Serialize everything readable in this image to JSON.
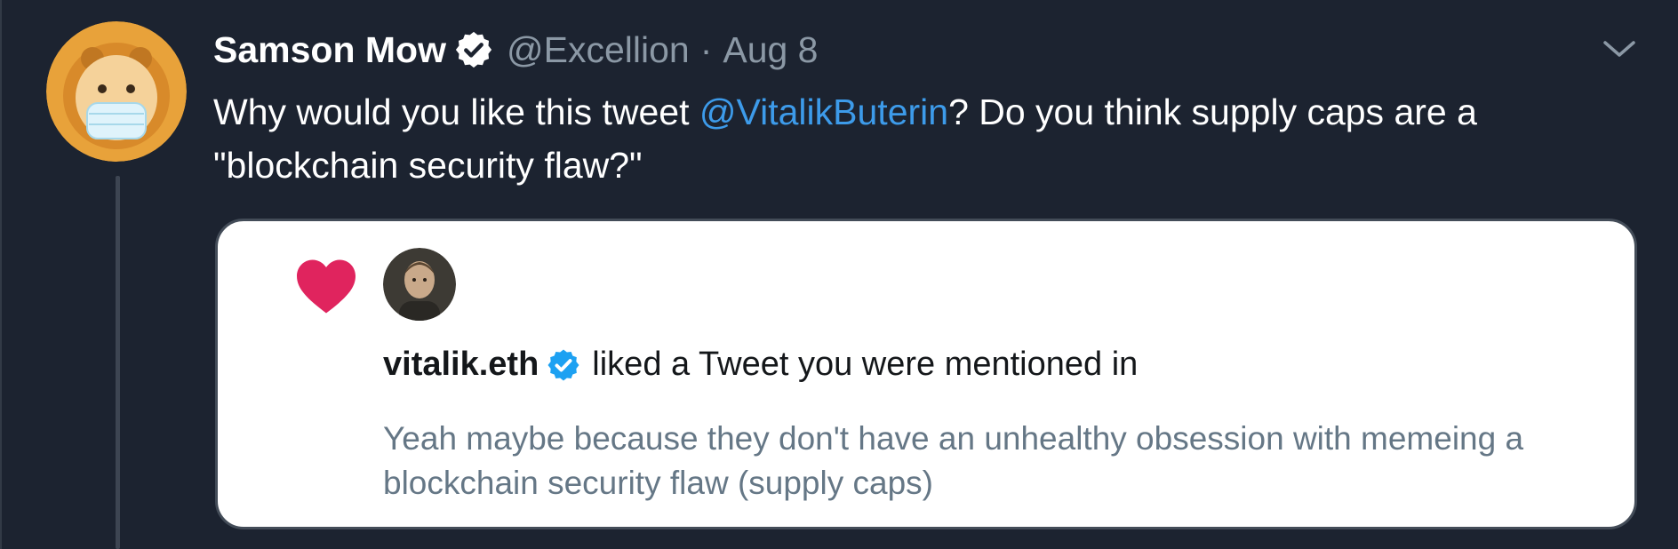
{
  "tweet": {
    "author_name": "Samson Mow",
    "author_handle": "@Excellion",
    "separator": "·",
    "date": "Aug 8",
    "text_before": "Why would you like this tweet ",
    "mention": "@VitalikButerin",
    "text_after": "? Do you think supply caps are a \"blockchain security flaw?\""
  },
  "notification_card": {
    "liker_name": "vitalik.eth",
    "liked_text": "liked a Tweet you were mentioned in",
    "quoted_text": "Yeah maybe because they don't have an unhealthy obsession with memeing a blockchain security flaw (supply caps)"
  },
  "icons": {
    "verified": "verified-badge-icon",
    "more": "chevron-down-icon",
    "like": "heart-icon"
  },
  "colors": {
    "background": "#1c2330",
    "mention": "#3d9bea",
    "heart": "#e0245e",
    "verified_dark": "#ffffff",
    "verified_light": "#1da1f2"
  }
}
